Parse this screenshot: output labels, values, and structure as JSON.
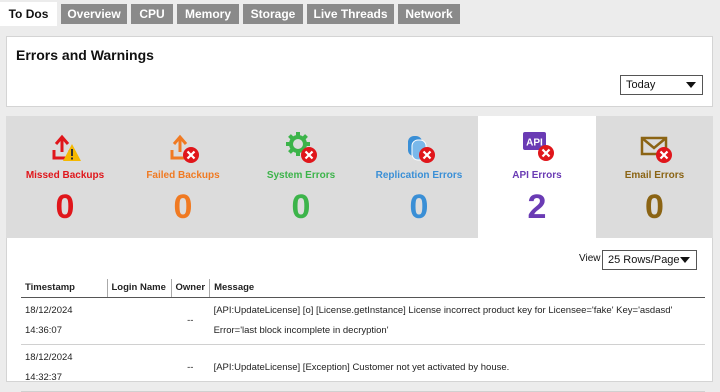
{
  "tabs": [
    {
      "label": "To Dos",
      "active": true
    },
    {
      "label": "Overview"
    },
    {
      "label": "CPU"
    },
    {
      "label": "Memory"
    },
    {
      "label": "Storage"
    },
    {
      "label": "Live Threads"
    },
    {
      "label": "Network"
    }
  ],
  "errors_panel": {
    "title": "Errors and Warnings",
    "period_select": "Today"
  },
  "cards": [
    {
      "label": "Missed Backups",
      "count": "0",
      "color": "#e0161b",
      "icon": "upload-warning-icon"
    },
    {
      "label": "Failed Backups",
      "count": "0",
      "color": "#f07a22",
      "icon": "upload-error-icon"
    },
    {
      "label": "System Errors",
      "count": "0",
      "color": "#3cb44a",
      "icon": "gear-error-icon"
    },
    {
      "label": "Replication Errors",
      "count": "0",
      "color": "#3a8fd6",
      "icon": "replication-error-icon"
    },
    {
      "label": "API Errors",
      "count": "2",
      "color": "#6a3bb4",
      "icon": "api-error-icon",
      "active": true
    },
    {
      "label": "Email Errors",
      "count": "0",
      "color": "#8b6414",
      "icon": "email-error-icon"
    }
  ],
  "table_panel": {
    "view_label": "View",
    "rows_select": "25 Rows/Page",
    "columns": [
      "Timestamp",
      "Login Name",
      "Owner",
      "Message"
    ],
    "rows": [
      {
        "date": "18/12/2024",
        "time": "14:36:07",
        "login": "",
        "owner": "--",
        "message_1": "[API:UpdateLicense] [o] [License.getInstance] License incorrect product key for Licensee='fake' Key='asdasd'",
        "message_2": "Error='last block incomplete in decryption'"
      },
      {
        "date": "18/12/2024",
        "time": "14:32:37",
        "login": "",
        "owner": "--",
        "message_1": "[API:UpdateLicense] [Exception] Customer not yet activated by house.",
        "message_2": ""
      }
    ]
  }
}
